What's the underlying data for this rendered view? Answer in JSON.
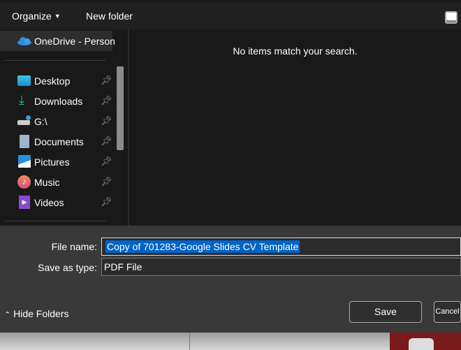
{
  "toolbar": {
    "organize": "Organize",
    "new_folder": "New folder",
    "view_icon": "preview-pane-icon"
  },
  "nav": {
    "onedrive": "OneDrive - Person",
    "items": [
      {
        "label": "Desktop",
        "icon": "desktop-icon"
      },
      {
        "label": "Downloads",
        "icon": "download-icon"
      },
      {
        "label": "G:\\",
        "icon": "drive-icon"
      },
      {
        "label": "Documents",
        "icon": "documents-icon"
      },
      {
        "label": "Pictures",
        "icon": "pictures-icon"
      },
      {
        "label": "Music",
        "icon": "music-icon"
      },
      {
        "label": "Videos",
        "icon": "videos-icon"
      }
    ]
  },
  "content": {
    "empty_message": "No items match your search."
  },
  "form": {
    "file_name_label": "File name:",
    "file_name_value": "Copy of 701283-Google Slides CV Template",
    "type_label": "Save as type:",
    "type_value": "PDF File"
  },
  "footer": {
    "hide_folders": "Hide Folders",
    "save": "Save",
    "cancel": "Cancel"
  },
  "colors": {
    "selection": "#0063c6",
    "onedrive": "#2b8fe0",
    "download": "#2dbb8f"
  }
}
